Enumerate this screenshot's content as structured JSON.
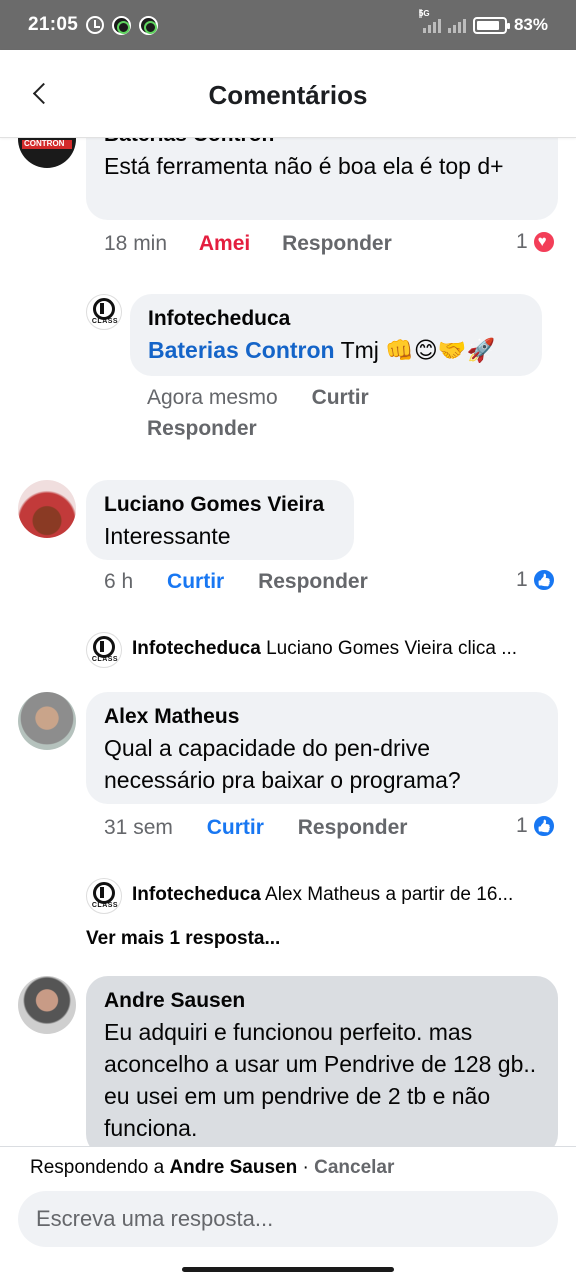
{
  "status_bar": {
    "time": "21:05",
    "network": "5G",
    "battery": "83%",
    "battery_level": 0.83
  },
  "header": {
    "title": "Comentários"
  },
  "comments": [
    {
      "author": "Baterias Contron",
      "avatar_text": "CONTRON",
      "text": "Está ferramenta não é boa ela é  top d+",
      "time": "18 min",
      "reaction_label": "Amei",
      "reply_label": "Responder",
      "reaction_count": "1",
      "reaction_icon": "heart-icon"
    },
    {
      "author": "Luciano Gomes Vieira",
      "text": "Interessante",
      "time": "6 h",
      "reaction_label": "Curtir",
      "reply_label": "Responder",
      "reaction_count": "1",
      "reaction_icon": "like-icon"
    },
    {
      "author": "Alex Matheus",
      "text": "Qual a capacidade do pen-drive necessário pra baixar o programa?",
      "time": "31 sem",
      "reaction_label": "Curtir",
      "reply_label": "Responder",
      "reaction_count": "1",
      "reaction_icon": "like-icon"
    },
    {
      "author": "Andre Sausen",
      "text": "Eu adquiri e funcionou perfeito.   mas aconcelho a usar um Pendrive de 128 gb..  eu usei em um pendrive de 2 tb e não funciona."
    }
  ],
  "replies": [
    {
      "author": "Infotecheduca",
      "logo_text": "CLASS",
      "mention": "Baterias Contron",
      "text": " Tmj 👊😊🤝🚀",
      "time": "Agora mesmo",
      "like_label": "Curtir",
      "reply_label": "Responder"
    }
  ],
  "reply_previews": [
    {
      "author": "Infotecheduca",
      "text": "Luciano Gomes Vieira clica ..."
    },
    {
      "author": "Infotecheduca",
      "text": "Alex Matheus a partir de 16..."
    }
  ],
  "see_more": "Ver mais 1 resposta...",
  "composer": {
    "replying_prefix": "Respondendo a ",
    "replying_to": "Andre Sausen",
    "separator": " · ",
    "cancel": "Cancelar",
    "placeholder": "Escreva uma resposta..."
  },
  "colors": {
    "bubble": "#f0f2f5",
    "link_blue": "#1877f2",
    "love_red": "#e41e3f",
    "muted": "#65676b"
  }
}
